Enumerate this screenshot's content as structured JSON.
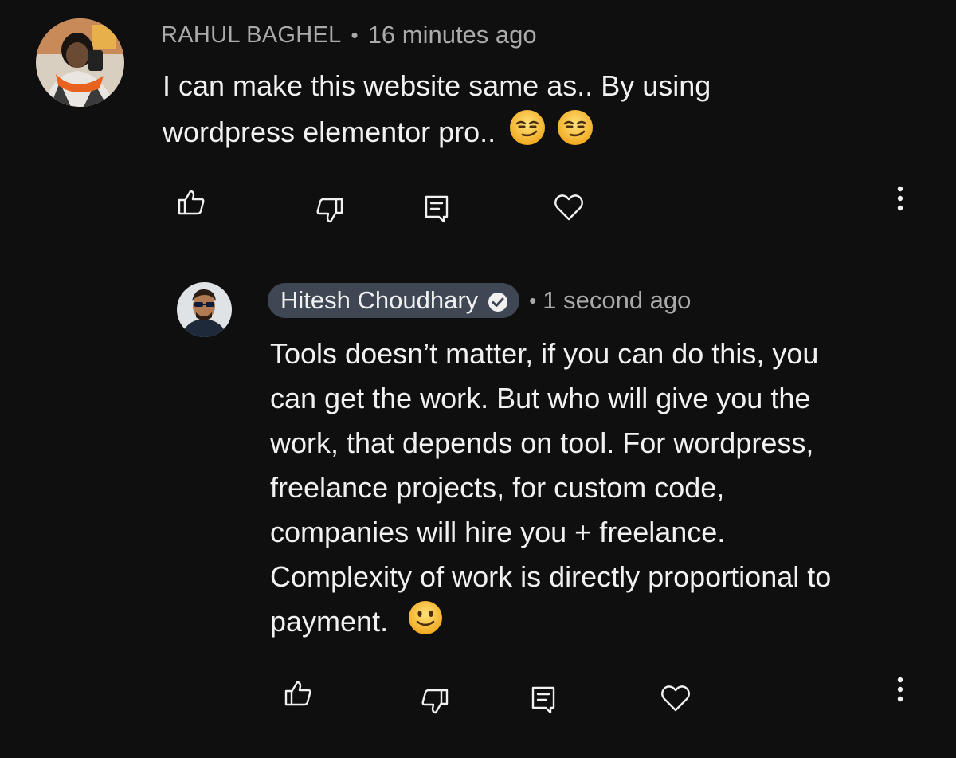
{
  "comment": {
    "author": "RAHUL BAGHEL",
    "separator": "•",
    "time": "16 minutes ago",
    "text_line1": "I can make this website same as.. By using",
    "text_line2": "wordpress elementor pro..",
    "avatar_icon": "user-avatar-icon",
    "emoji_icon": "smirking-face-emoji"
  },
  "reply": {
    "author": "Hitesh Choudhary",
    "verified_icon": "verified-check-icon",
    "separator": "•",
    "time": "1 second ago",
    "lines": [
      "Tools doesn’t matter, if you can do this, you",
      "can get the work. But who will give you the",
      "work, that depends on tool. For wordpress,",
      "freelance projects, for custom code,",
      "companies will hire you + freelance.",
      "Complexity of work is directly proportional to",
      "payment."
    ],
    "emoji_icon": "slightly-smiling-face-emoji"
  },
  "actions": [
    "like-icon",
    "dislike-icon",
    "reply-icon",
    "heart-icon",
    "more-vertical-icon"
  ],
  "colors": {
    "background": "#0f0f0f",
    "text": "#f1f1f1",
    "muted": "#aaaaaa",
    "author_pill": "#3f4755",
    "emoji": "#f4c430"
  }
}
